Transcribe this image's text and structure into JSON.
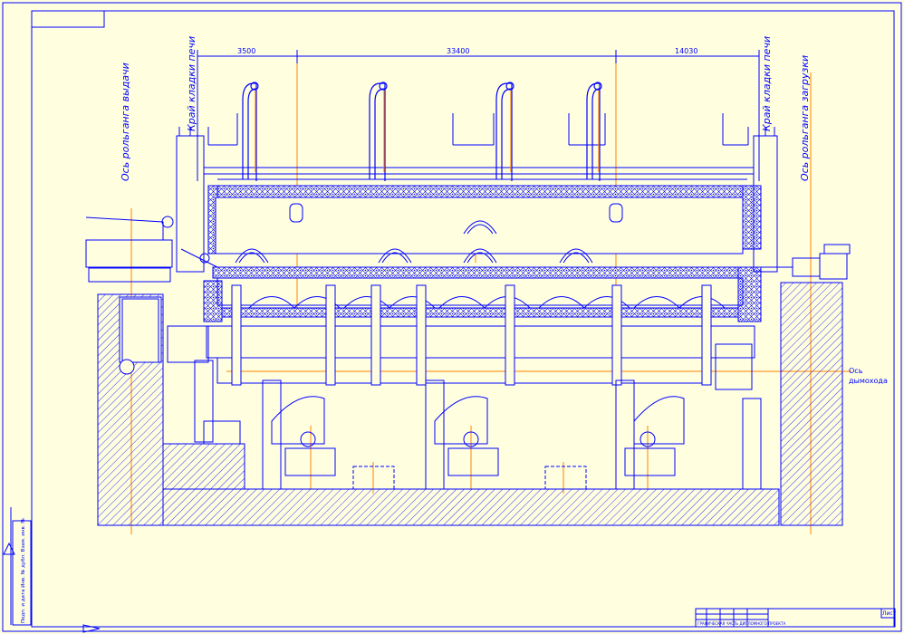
{
  "colors": {
    "background": "#ffffe0",
    "line": "#0000ff",
    "axis": "#ff8000"
  },
  "dimensions": {
    "d1": "3500",
    "d2": "33400",
    "d3": "14030"
  },
  "labels": {
    "axis_unload": "Ось рольганга выдачи",
    "furnace_edge_left": "Край кладки печи",
    "furnace_edge_right": "Край кладки печи",
    "axis_load": "Ось рольганга загрузки",
    "flue_axis_line1": "Ось",
    "flue_axis_line2": "дымохода"
  },
  "title_block": {
    "sheet_label": "Лист",
    "doc_code": "ГРАФИЧЕСКАЯ ЧАСТЬ ДИПЛОМНОГО ПРОЕКТА"
  },
  "side_stamp": {
    "text": "Подп. и дата   Инв. № дубл.   Взам. инв. №"
  }
}
